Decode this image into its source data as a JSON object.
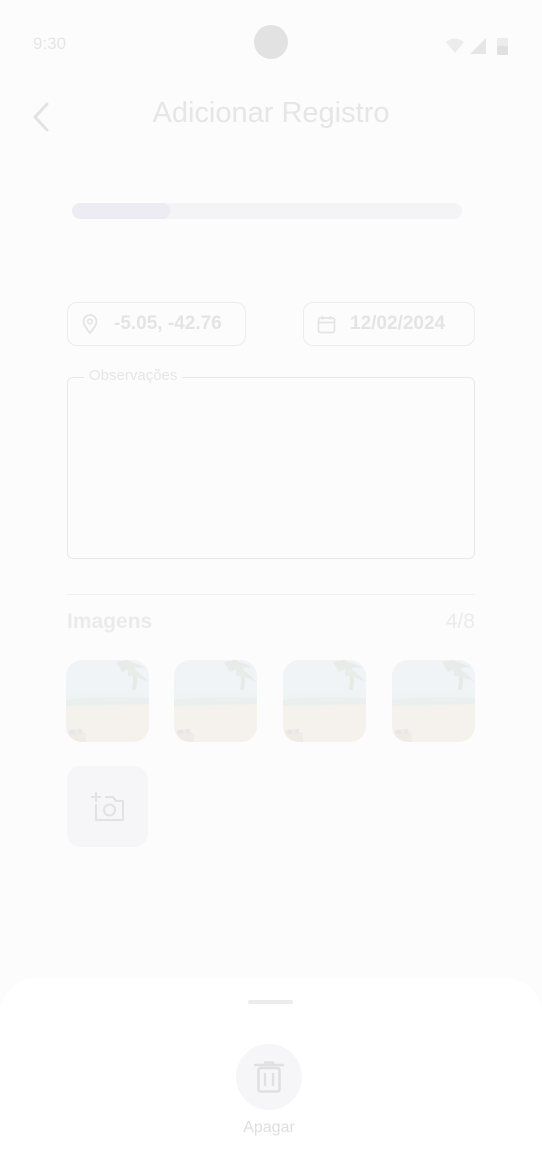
{
  "status_bar": {
    "time": "9:30"
  },
  "header": {
    "title": "Adicionar Registro"
  },
  "progress": {
    "fraction": 0.25
  },
  "location": {
    "value": "-5.05, -42.76",
    "icon": "map-pin-icon"
  },
  "date": {
    "value": "12/02/2024",
    "icon": "calendar-icon"
  },
  "notes": {
    "label": "Observações",
    "value": ""
  },
  "images": {
    "title": "Imagens",
    "count": "4/8",
    "thumbnails": [
      "beach-photo",
      "beach-photo",
      "beach-photo",
      "beach-photo"
    ]
  },
  "sheet": {
    "delete_label": "Apagar",
    "delete_icon": "trash-icon"
  }
}
